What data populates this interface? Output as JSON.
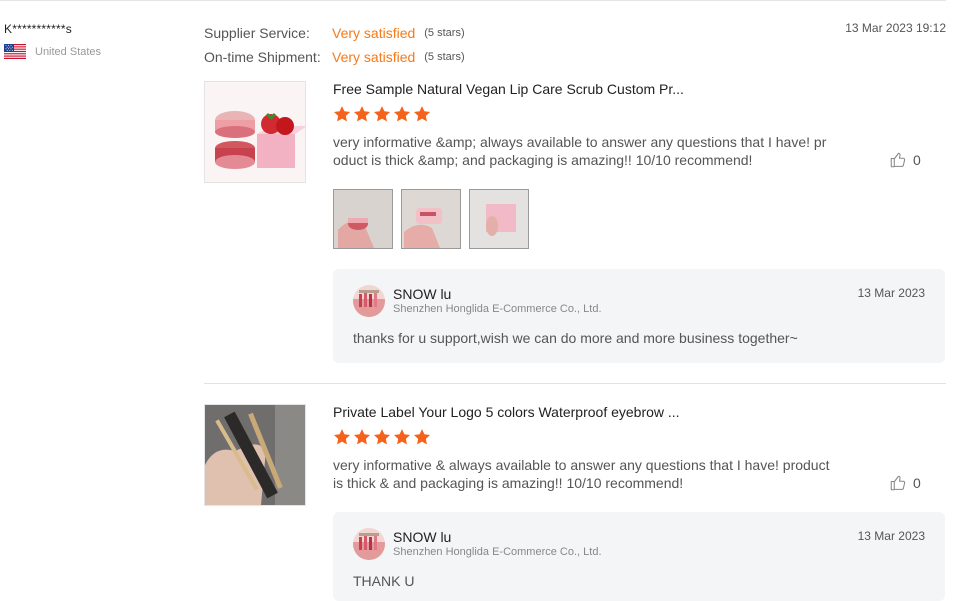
{
  "reviewer": {
    "name": "K***********s",
    "country": "United States",
    "flag_icon": "us-flag-icon"
  },
  "ratings": [
    {
      "label": "Supplier Service:",
      "value": "Very satisfied",
      "stars_text": "(5 stars)"
    },
    {
      "label": "On-time Shipment:",
      "value": "Very satisfied",
      "stars_text": "(5 stars)"
    }
  ],
  "review_date": "13 Mar 2023 19:12",
  "colors": {
    "accent": "#f47a1a",
    "star": "#f5621c",
    "reply_bg": "#f4f5f7"
  },
  "reviews": [
    {
      "product_title": "Free Sample Natural Vegan Lip Care Scrub Custom Pr...",
      "rating": 5,
      "text": "very informative &amp; always available to answer any questions that I have! product is thick &amp; and packaging is amazing!! 10/10 recommend!",
      "likes": "0",
      "photo_count": 3,
      "reply": {
        "name": "SNOW lu",
        "company": "Shenzhen Honglida E-Commerce Co., Ltd.",
        "date": "13 Mar 2023",
        "text": "thanks for u support,wish we can do more and more business together~"
      }
    },
    {
      "product_title": "Private Label Your Logo 5 colors Waterproof eyebrow ...",
      "rating": 5,
      "text": "very informative & always available to answer any questions that I have! product is thick & and packaging is amazing!! 10/10 recommend!",
      "likes": "0",
      "reply": {
        "name": "SNOW lu",
        "company": "Shenzhen Honglida E-Commerce Co., Ltd.",
        "date": "13 Mar 2023",
        "text": "THANK U"
      }
    }
  ]
}
